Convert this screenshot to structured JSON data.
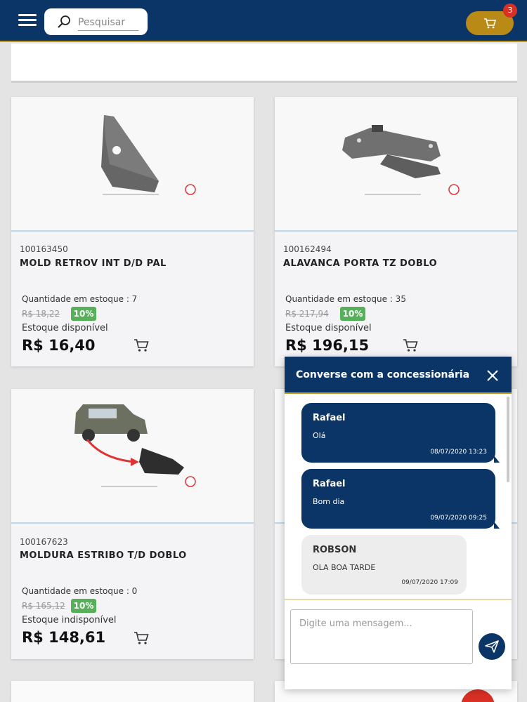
{
  "header": {
    "search_placeholder": "Pesquisar",
    "cart_count": "3"
  },
  "products": [
    {
      "code": "100163450",
      "name": "MOLD RETROV INT D/D PAL",
      "qty_label": "Quantidade em estoque : 7",
      "old_price": "R$ 18,22",
      "discount": "10%",
      "availability": "Estoque disponível",
      "price": "R$ 16,40"
    },
    {
      "code": "100162494",
      "name": "ALAVANCA PORTA TZ DOBLO",
      "qty_label": "Quantidade em estoque : 35",
      "old_price": "R$ 217,94",
      "discount": "10%",
      "availability": "Estoque disponível",
      "price": "R$ 196,15"
    },
    {
      "code": "100167623",
      "name": "MOLDURA ESTRIBO T/D DOBLO",
      "qty_label": "Quantidade em estoque : 0",
      "old_price": "R$ 165,12",
      "discount": "10%",
      "availability": "Estoque indisponível",
      "price": "R$ 148,61"
    }
  ],
  "chat": {
    "title": "Converse com a concessionária",
    "messages": [
      {
        "author": "Rafael",
        "text": "Olá",
        "time": "08/07/2020 13:23",
        "type": "agent"
      },
      {
        "author": "Rafael",
        "text": "Bom dia",
        "time": "09/07/2020 09:25",
        "type": "agent"
      },
      {
        "author": "ROBSON",
        "text": "OLA BOA TARDE",
        "time": "09/07/2020 17:09",
        "type": "user"
      }
    ],
    "input_placeholder": "Digite uma mensagem..."
  },
  "colors": {
    "primary": "#0b3566",
    "accent": "#c49a1c",
    "discount": "#56b05a",
    "badge": "#d93025"
  }
}
